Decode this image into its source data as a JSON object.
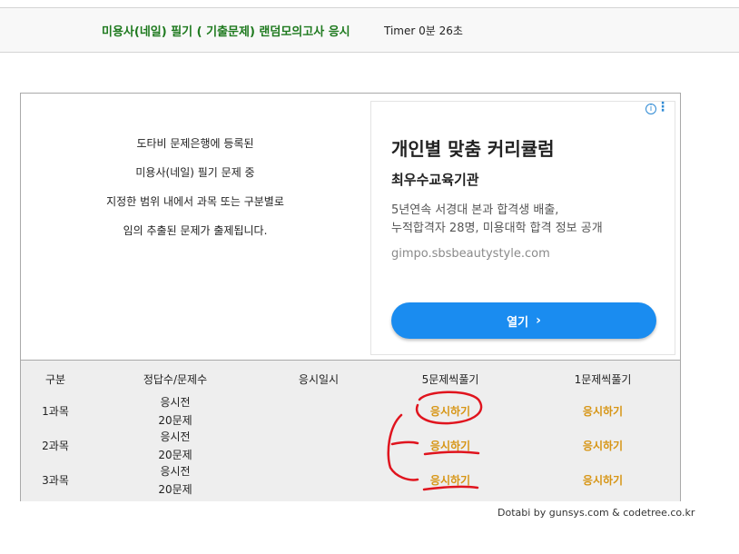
{
  "header": {
    "title": "미용사(네일) 필기 ( 기출문제) 랜덤모의고사 응시",
    "timer": "Timer 0분 26초"
  },
  "intro": {
    "lines": [
      "도타비 문제은행에 등록된",
      "미용사(네일) 필기 문제 중",
      "지정한 범위 내에서 과목 또는 구분별로",
      "임의 추출된 문제가 출제됩니다."
    ]
  },
  "ad": {
    "info_icon": "info-icon",
    "more_icon": "more-vert-icon",
    "headline": "개인별 맞춤 커리큘럼",
    "advertiser": "최우수교육기관",
    "desc_lines": [
      "5년연속 서경대 본과 합격생 배출,",
      "누적합격자 28명, 미용대학 합격 정보 공개"
    ],
    "url": "gimpo.sbsbeautystyle.com",
    "button_label": "열기",
    "button_icon": "chevron-right-icon",
    "button_color": "#1a8cf0"
  },
  "table": {
    "headers": [
      "구분",
      "정답수/문제수",
      "응시일시",
      "5문제씩풀기",
      "1문제씩풀기"
    ],
    "rows": [
      {
        "subject": "1과목",
        "status": "응시전",
        "count": "20문제",
        "action5": "응시하기",
        "action1": "응시하기"
      },
      {
        "subject": "2과목",
        "status": "응시전",
        "count": "20문제",
        "action5": "응시하기",
        "action1": "응시하기"
      },
      {
        "subject": "3과목",
        "status": "응시전",
        "count": "20문제",
        "action5": "응시하기",
        "action1": "응시하기"
      }
    ],
    "action_color": "#d79514"
  },
  "footer": "Dotabi by gunsys.com & codetree.co.kr",
  "annotation_color": "#e0141e"
}
